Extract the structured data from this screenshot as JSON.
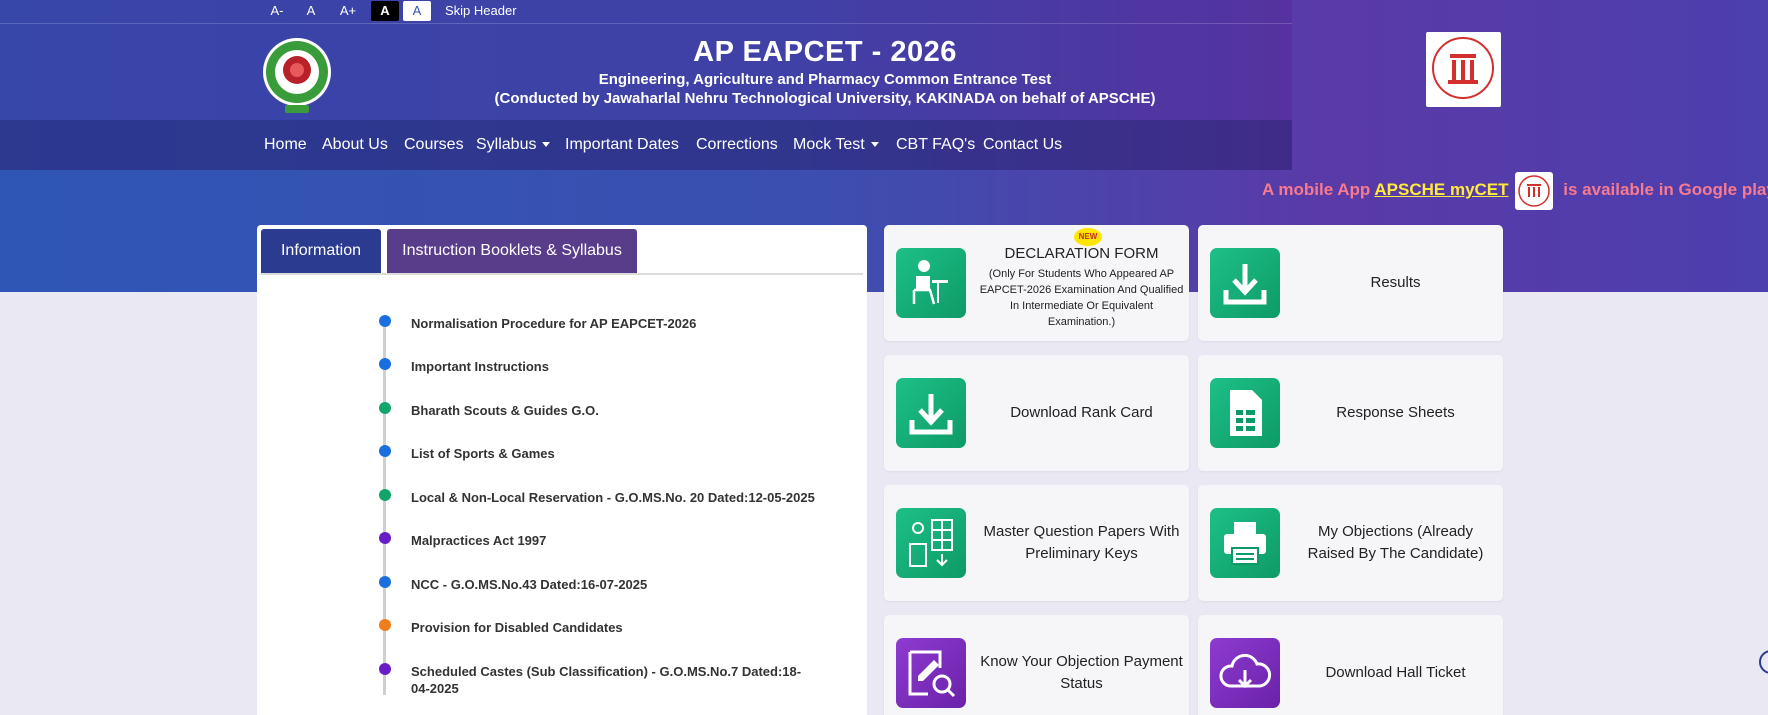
{
  "accessibility": {
    "font_decrease": "A-",
    "font_normal": "A",
    "font_increase": "A+",
    "theme_dark": "A",
    "theme_light": "A",
    "skip_header": "Skip Header"
  },
  "header": {
    "title": "AP EAPCET - 2026",
    "subtitle": "Engineering, Agriculture and Pharmacy Common Entrance Test",
    "conducted_by": "(Conducted by Jawaharlal Nehru Technological University, KAKINADA on behalf of APSCHE)"
  },
  "nav": {
    "items": [
      {
        "label": "Home"
      },
      {
        "label": "About Us"
      },
      {
        "label": "Courses"
      },
      {
        "label": "Syllabus",
        "dropdown": true
      },
      {
        "label": "Important Dates"
      },
      {
        "label": "Corrections"
      },
      {
        "label": "Mock Test",
        "dropdown": true
      },
      {
        "label": "CBT FAQ's"
      },
      {
        "label": "Contact Us"
      }
    ]
  },
  "marquee": {
    "prefix": "A mobile App ",
    "link": "APSCHE myCET",
    "suffix": " is available in Google play s"
  },
  "tabs": {
    "information": "Information",
    "instruction": "Instruction Booklets & Syllabus"
  },
  "info_list": [
    {
      "text": "Normalisation Procedure for AP EAPCET-2026",
      "color": "#1a6fe0"
    },
    {
      "text": "Important Instructions",
      "color": "#1a6fe0"
    },
    {
      "text": "Bharath Scouts & Guides G.O.",
      "color": "#12a56a"
    },
    {
      "text": "List of Sports & Games",
      "color": "#1a6fe0"
    },
    {
      "text": "Local & Non-Local Reservation - G.O.MS.No. 20 Dated:12-05-2025",
      "color": "#12a56a"
    },
    {
      "text": "Malpractices Act 1997",
      "color": "#6a1bc8"
    },
    {
      "text": "NCC - G.O.MS.No.43 Dated:16-07-2025",
      "color": "#1a6fe0"
    },
    {
      "text": "Provision for Disabled Candidates",
      "color": "#f07c1a"
    },
    {
      "text": "Scheduled Castes (Sub Classification) - G.O.MS.No.7 Dated:18-04-2025",
      "color": "#6a1bc8"
    }
  ],
  "cards": {
    "declaration_title": "DECLARATION FORM",
    "declaration_note": "(Only For Students Who Appeared AP EAPCET-2026 Examination And Qualified In Intermediate Or Equivalent Examination.)",
    "new_badge": "NEW",
    "results": "Results",
    "rank_card": "Download Rank Card",
    "response_sheets": "Response Sheets",
    "master_papers": "Master Question Papers With Preliminary Keys",
    "my_objections": "My Objections (Already Raised By The Candidate)",
    "objection_status": "Know Your Objection Payment Status",
    "hall_ticket": "Download Hall Ticket"
  },
  "colors": {
    "accent_green": "#12a56a",
    "accent_purple": "#6a21a9",
    "tab_info": "#2b3b8f",
    "tab_instr": "#5a3d8a",
    "marquee_text": "#f77a8e",
    "marquee_link": "#ffeb3b"
  }
}
